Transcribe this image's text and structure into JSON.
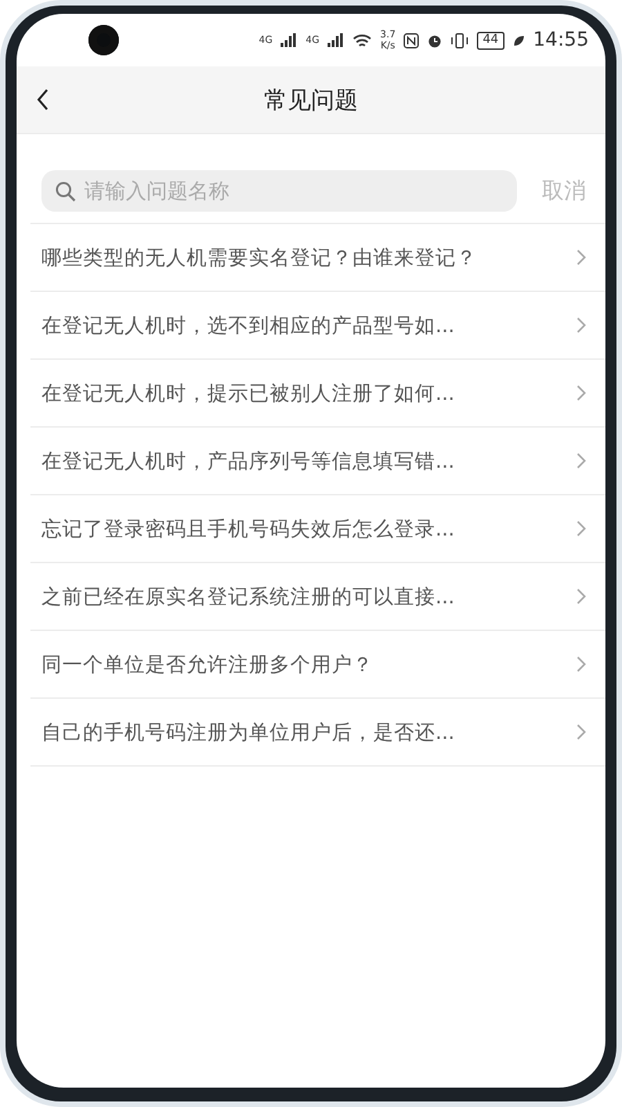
{
  "status_bar": {
    "signal_labels": [
      "4G",
      "4G"
    ],
    "speed_value": "3.7",
    "speed_unit": "K/s",
    "battery": "44",
    "time": "14:55"
  },
  "header": {
    "title": "常见问题"
  },
  "search": {
    "placeholder": "请输入问题名称",
    "cancel": "取消"
  },
  "questions": [
    {
      "text": "哪些类型的无人机需要实名登记？由谁来登记？"
    },
    {
      "text": "在登记无人机时，选不到相应的产品型号如..."
    },
    {
      "text": "在登记无人机时，提示已被别人注册了如何..."
    },
    {
      "text": "在登记无人机时，产品序列号等信息填写错..."
    },
    {
      "text": "忘记了登录密码且手机号码失效后怎么登录..."
    },
    {
      "text": "之前已经在原实名登记系统注册的可以直接..."
    },
    {
      "text": "同一个单位是否允许注册多个用户？"
    },
    {
      "text": "自己的手机号码注册为单位用户后，是否还..."
    }
  ]
}
